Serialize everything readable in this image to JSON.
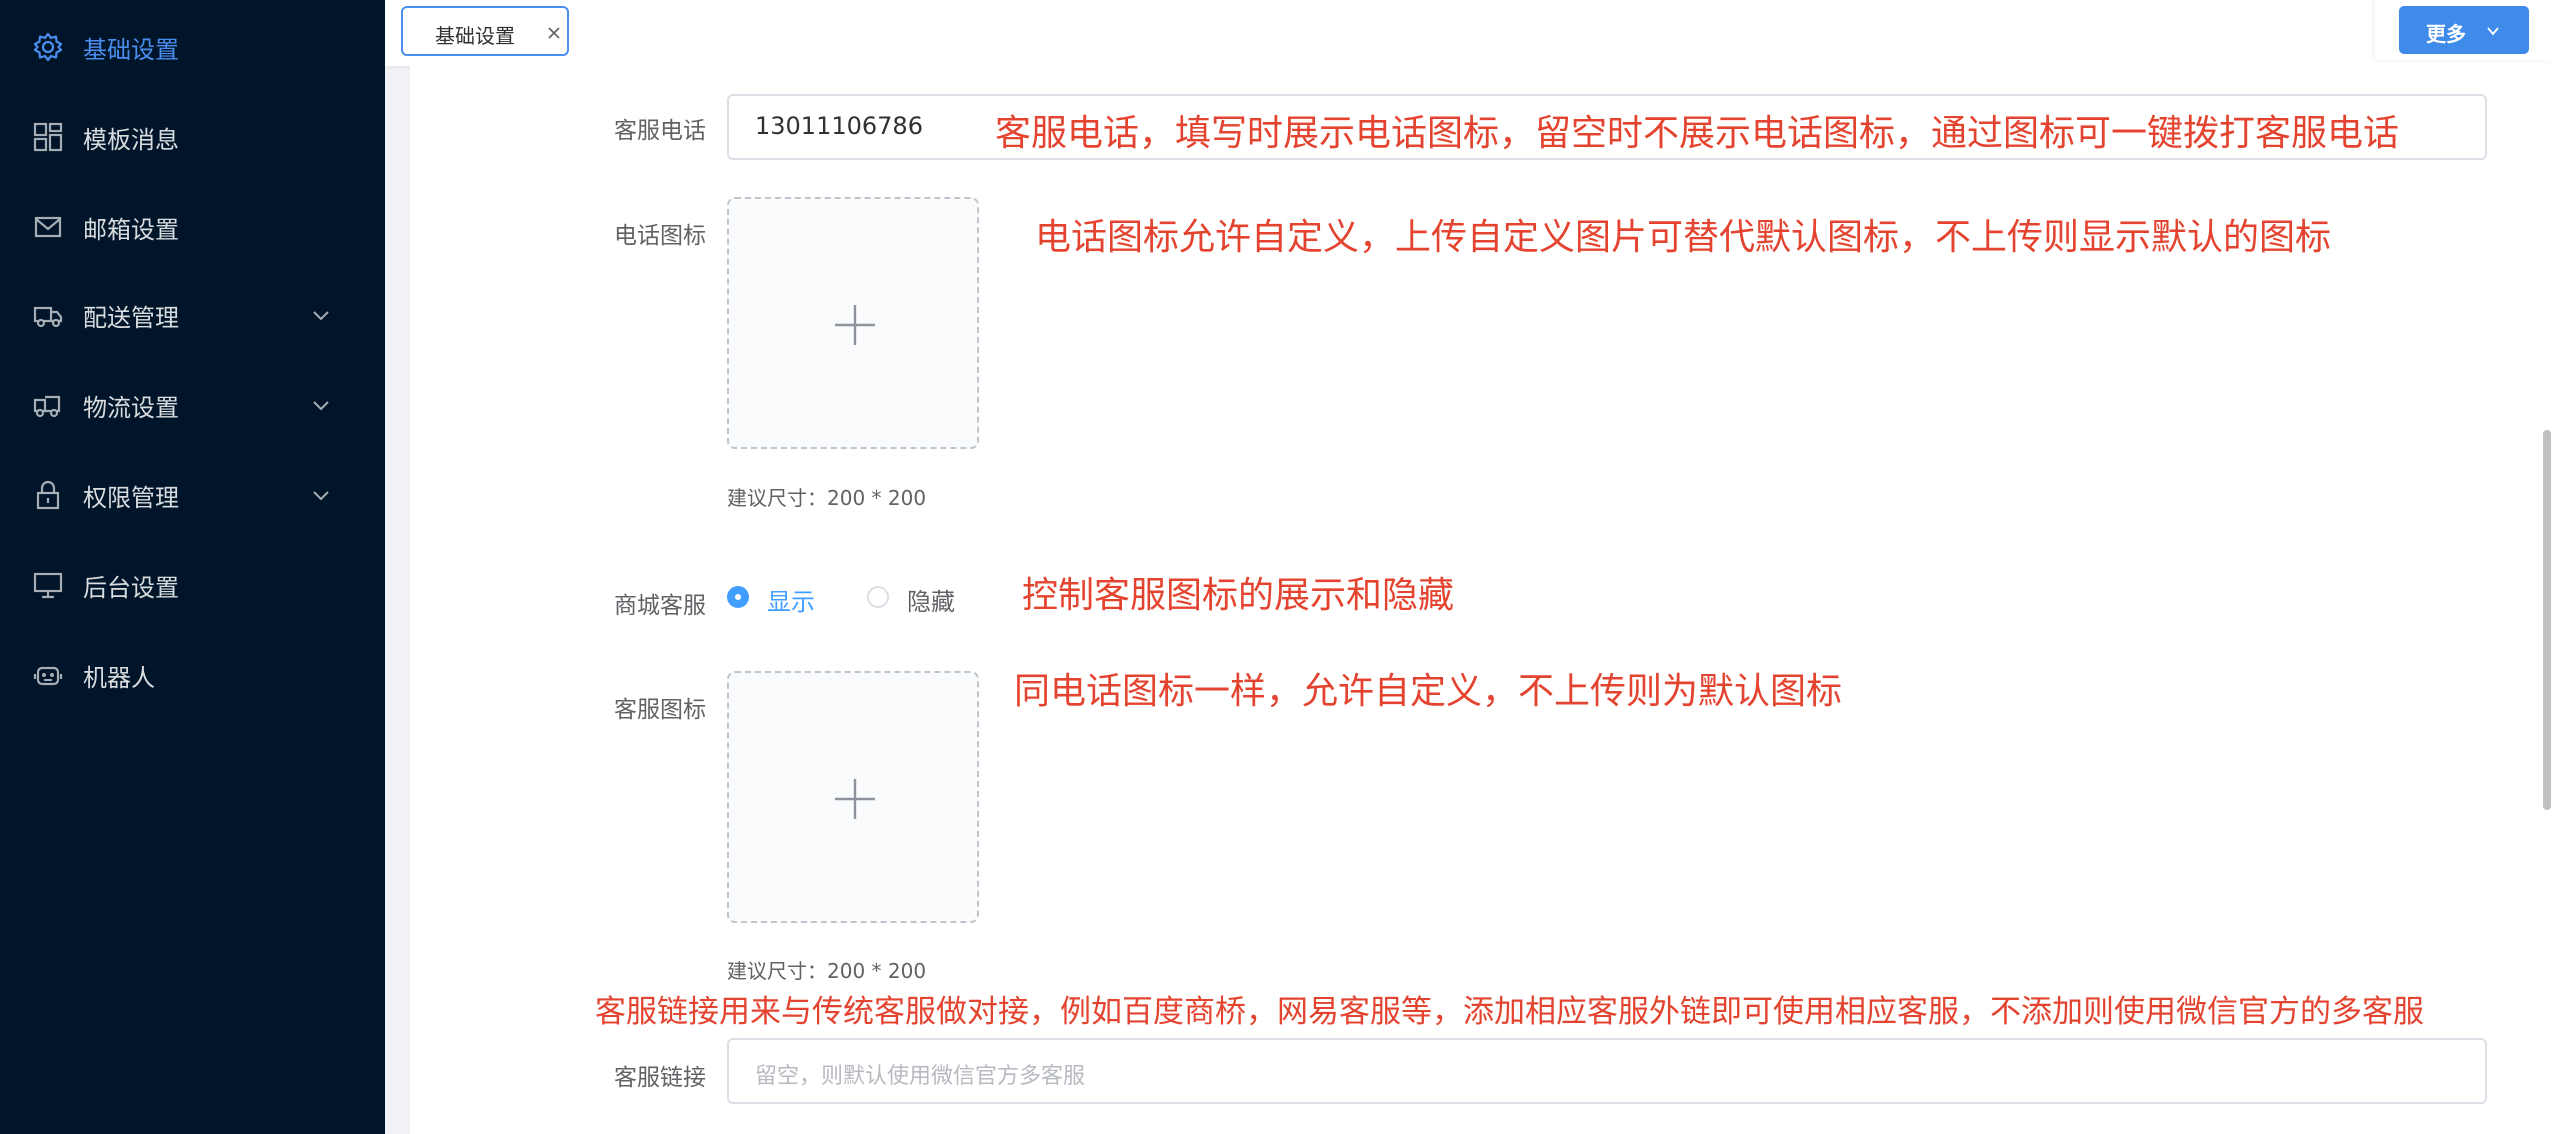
{
  "sidebar": {
    "items": [
      {
        "label": "基础设置",
        "icon": "gear-icon",
        "active": true
      },
      {
        "label": "模板消息",
        "icon": "grid-icon"
      },
      {
        "label": "邮箱设置",
        "icon": "mail-icon"
      },
      {
        "label": "配送管理",
        "icon": "delivery-truck-icon",
        "expandable": true
      },
      {
        "label": "物流设置",
        "icon": "logistics-truck-icon",
        "expandable": true
      },
      {
        "label": "权限管理",
        "icon": "lock-icon",
        "expandable": true
      },
      {
        "label": "后台设置",
        "icon": "monitor-icon"
      },
      {
        "label": "机器人",
        "icon": "robot-icon"
      }
    ]
  },
  "tabs": [
    {
      "label": "基础设置",
      "active": true
    }
  ],
  "toolbar": {
    "more_label": "更多"
  },
  "form": {
    "service_phone": {
      "label": "客服电话",
      "value": "13011106786"
    },
    "phone_icon": {
      "label": "电话图标",
      "hint": "建议尺寸：200 * 200"
    },
    "mall_service": {
      "label": "商城客服",
      "options": [
        {
          "label": "显示",
          "checked": true
        },
        {
          "label": "隐藏",
          "checked": false
        }
      ]
    },
    "service_icon": {
      "label": "客服图标",
      "hint": "建议尺寸：200 * 200"
    },
    "service_link": {
      "label": "客服链接",
      "placeholder": "留空，则默认使用微信官方多客服"
    }
  },
  "annotations": {
    "phone": "客服电话，填写时展示电话图标，留空时不展示电话图标，通过图标可一键拨打客服电话",
    "phone_icon": "电话图标允许自定义，上传自定义图片可替代默认图标，不上传则显示默认的图标",
    "mall_service": "控制客服图标的展示和隐藏",
    "service_icon": "同电话图标一样，允许自定义，不上传则为默认图标",
    "service_link": "客服链接用来与传统客服做对接，例如百度商桥，网易客服等，添加相应客服外链即可使用相应客服，不添加则使用微信官方的多客服"
  },
  "colors": {
    "sidebar_bg": "#001529",
    "accent": "#409eff",
    "annotation_red": "#e4442f"
  }
}
